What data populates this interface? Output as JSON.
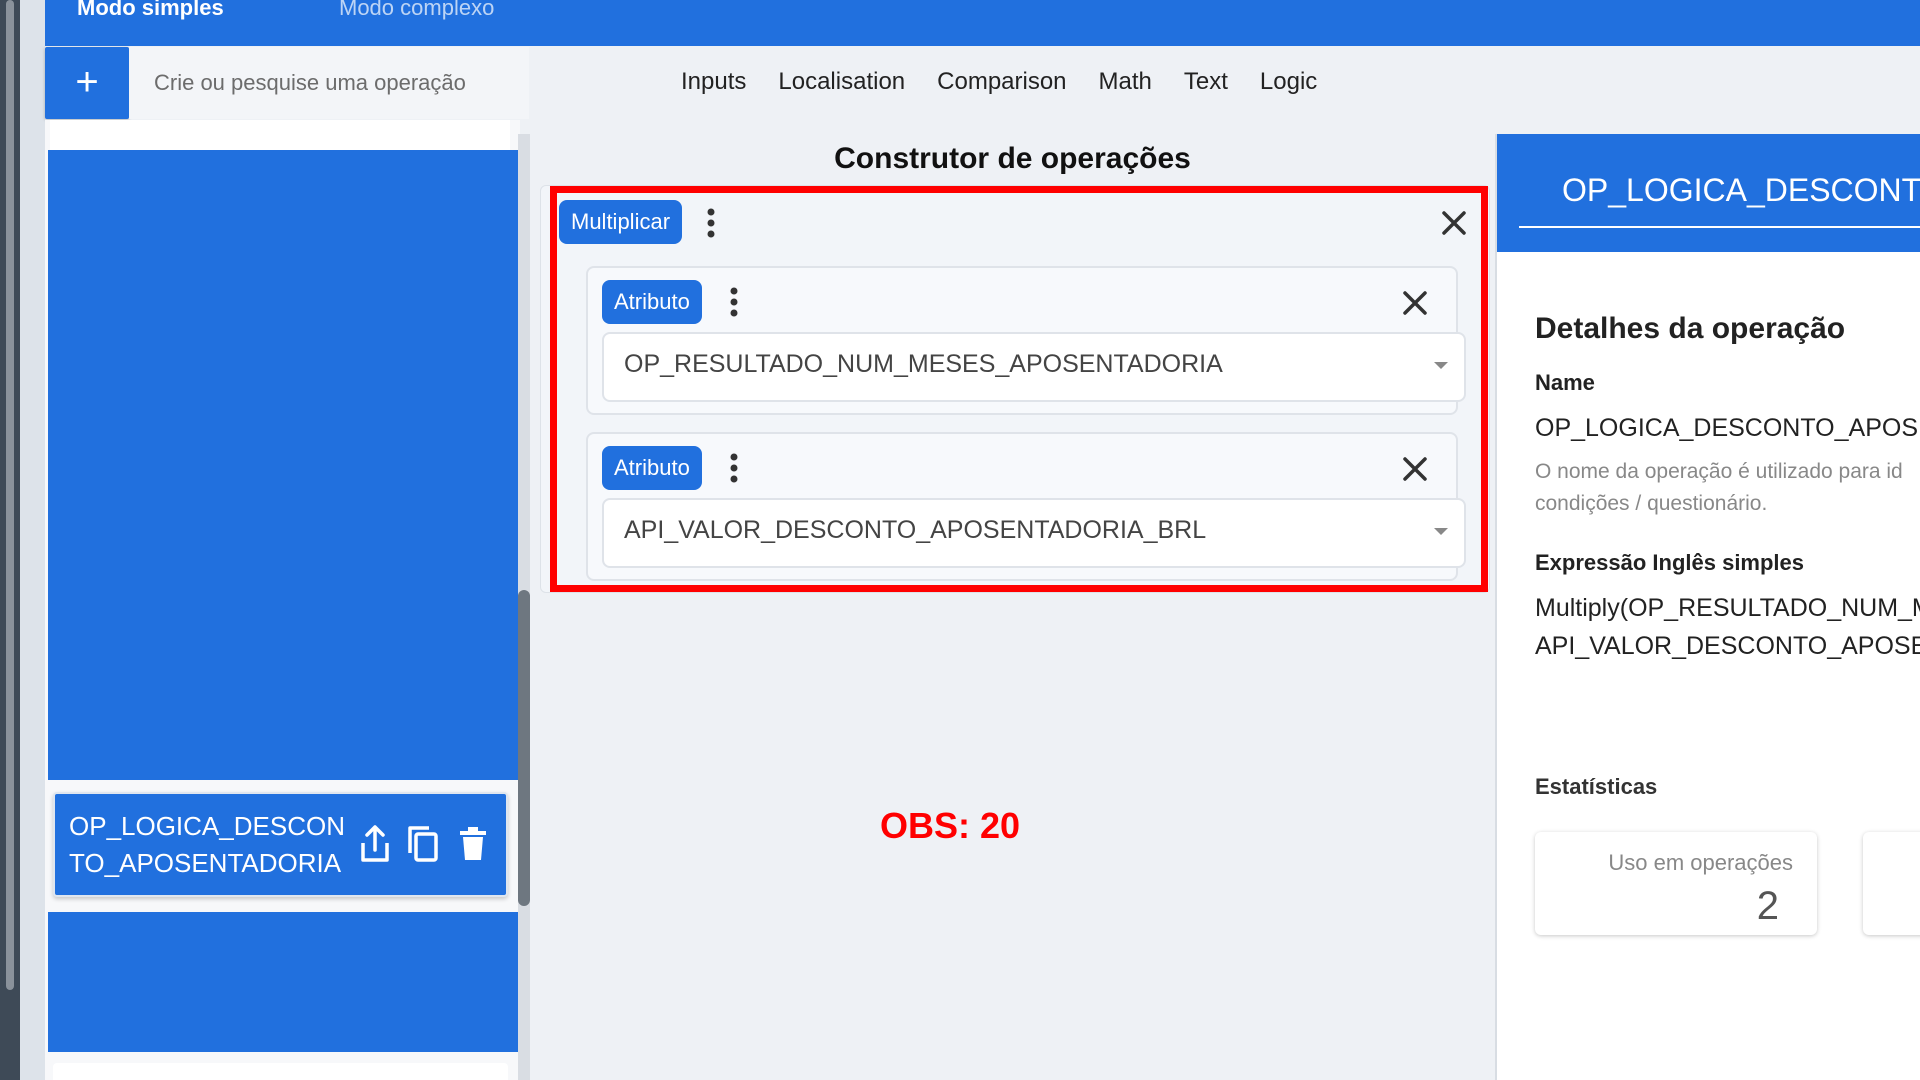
{
  "mode_tabs": {
    "simple": "Modo simples",
    "complex": "Modo complexo"
  },
  "toolbar": {
    "add_label": "+",
    "search_placeholder": "Crie ou pesquise uma operação",
    "categories": [
      "Inputs",
      "Localisation",
      "Comparison",
      "Math",
      "Text",
      "Logic"
    ]
  },
  "list": {
    "selected_item": "OP_LOGICA_DESCONTO_APOSENTADORIA",
    "icons": [
      "share-icon",
      "copy-icon",
      "delete-icon"
    ]
  },
  "builder": {
    "title": "Construtor de operações",
    "root_chip": "Multiplicar",
    "operands": [
      {
        "chip": "Atributo",
        "value": "OP_RESULTADO_NUM_MESES_APOSENTADORIA"
      },
      {
        "chip": "Atributo",
        "value": "API_VALOR_DESCONTO_APOSENTADORIA_BRL"
      }
    ]
  },
  "annotation": "OBS: 20",
  "details": {
    "header_title": "OP_LOGICA_DESCONTO",
    "section_title": "Detalhes da operação",
    "name_label": "Name",
    "name_value": "OP_LOGICA_DESCONTO_APOS",
    "name_help_1": "O nome da operação é utilizado para id",
    "name_help_2": "condições / questionário.",
    "expression_label": "Expressão Inglês simples",
    "expression_line_1": "Multiply(OP_RESULTADO_NUM_M",
    "expression_line_2": "API_VALOR_DESCONTO_APOSE",
    "stats_label": "Estatísticas",
    "stat_usage_label": "Uso em operações",
    "stat_usage_value": "2"
  },
  "colors": {
    "primary": "#2170de",
    "highlight": "#ff0000",
    "background": "#eef1f5"
  }
}
